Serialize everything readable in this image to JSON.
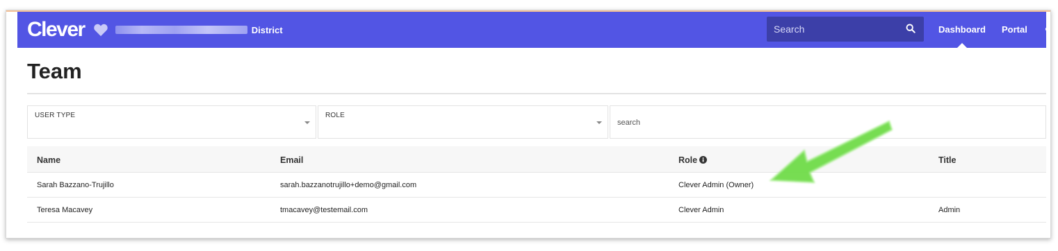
{
  "navbar": {
    "logo": "Clever",
    "district_suffix": "District",
    "search_placeholder": "Search",
    "links": [
      "Dashboard",
      "Portal"
    ],
    "accent_color": "#5255e4",
    "search_bg_color": "#3c3fa8"
  },
  "page": {
    "title": "Team"
  },
  "filters": {
    "user_type_label": "USER TYPE",
    "role_label": "ROLE",
    "search_placeholder": "search"
  },
  "table": {
    "columns": [
      "Name",
      "Email",
      "Role",
      "Title"
    ],
    "rows": [
      {
        "name": "Sarah Bazzano-Trujillo",
        "email": "sarah.bazzanotrujillo+demo@gmail.com",
        "role": "Clever Admin (Owner)",
        "title": ""
      },
      {
        "name": "Teresa Macavey",
        "email": "tmacavey@testemail.com",
        "role": "Clever Admin",
        "title": "Admin"
      }
    ]
  },
  "annotation": {
    "arrow_color": "#7ee05a",
    "icon": "arrow-pointer-icon"
  }
}
